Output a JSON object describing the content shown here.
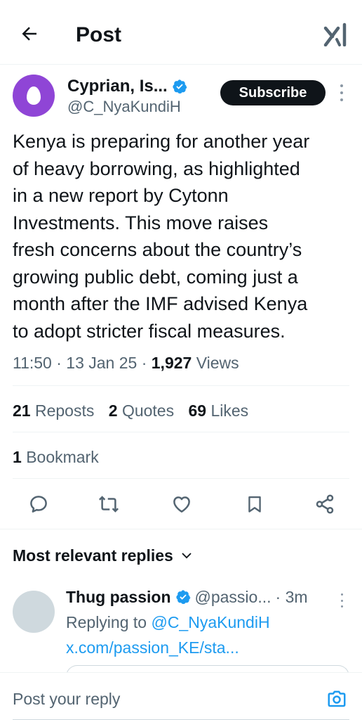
{
  "header": {
    "title": "Post",
    "back_icon": "arrow-left-icon",
    "grok_icon": "grok-icon"
  },
  "author": {
    "name": "Cyprian, Is...",
    "handle": "@C_NyaKundiH",
    "verified": true,
    "avatar_color": "#8f45d6",
    "subscribe_label": "Subscribe"
  },
  "post": {
    "text": "Kenya is preparing for another year\nof heavy borrowing, as highlighted\nin a new report by Cytonn\nInvestments. This move raises\nfresh concerns about the country’s\ngrowing public debt, coming just a\nmonth after the IMF advised Kenya\nto adopt stricter fiscal measures.",
    "time_date": "11:50 · 13 Jan 25 · ",
    "views_count": "1,927",
    "views_label": " Views"
  },
  "stats": {
    "reposts_count": "21",
    "reposts_label": "Reposts",
    "quotes_count": "2",
    "quotes_label": "Quotes",
    "likes_count": "69",
    "likes_label": "Likes",
    "bookmarks_count": "1",
    "bookmarks_label": "Bookmark"
  },
  "actions": [
    "reply-icon",
    "repost-icon",
    "like-icon",
    "bookmark-icon",
    "share-icon"
  ],
  "replies_section": {
    "sort_label": "Most relevant replies"
  },
  "reply": {
    "name": "Thug passion",
    "handle": "@passio...",
    "time": "· 3m",
    "replying_prefix": "Replying to ",
    "replying_to": "@C_NyaKundiH",
    "link": "x.com/passion_KE/sta..."
  },
  "composer": {
    "placeholder": "Post your reply"
  },
  "colors": {
    "accent": "#1d9bf0",
    "text": "#0f1419",
    "muted": "#536471"
  }
}
